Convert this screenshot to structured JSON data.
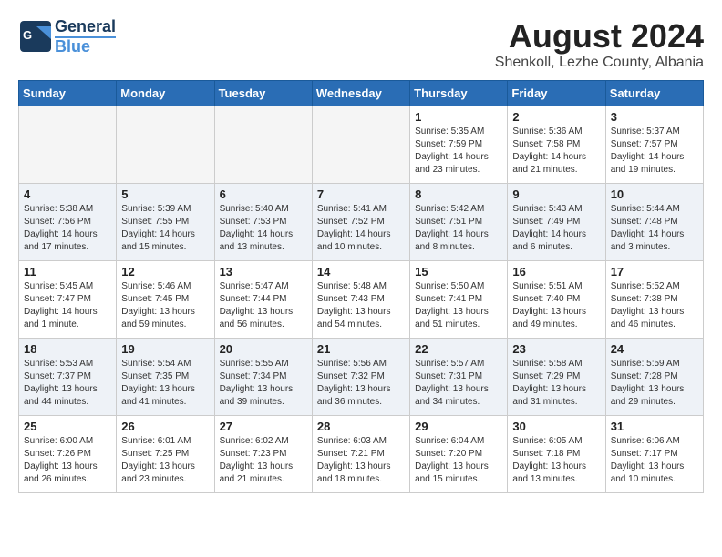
{
  "header": {
    "logo_line1": "General",
    "logo_line2": "Blue",
    "month_year": "August 2024",
    "location": "Shenkoll, Lezhe County, Albania"
  },
  "weekdays": [
    "Sunday",
    "Monday",
    "Tuesday",
    "Wednesday",
    "Thursday",
    "Friday",
    "Saturday"
  ],
  "weeks": [
    [
      {
        "day": "",
        "info": ""
      },
      {
        "day": "",
        "info": ""
      },
      {
        "day": "",
        "info": ""
      },
      {
        "day": "",
        "info": ""
      },
      {
        "day": "1",
        "info": "Sunrise: 5:35 AM\nSunset: 7:59 PM\nDaylight: 14 hours\nand 23 minutes."
      },
      {
        "day": "2",
        "info": "Sunrise: 5:36 AM\nSunset: 7:58 PM\nDaylight: 14 hours\nand 21 minutes."
      },
      {
        "day": "3",
        "info": "Sunrise: 5:37 AM\nSunset: 7:57 PM\nDaylight: 14 hours\nand 19 minutes."
      }
    ],
    [
      {
        "day": "4",
        "info": "Sunrise: 5:38 AM\nSunset: 7:56 PM\nDaylight: 14 hours\nand 17 minutes."
      },
      {
        "day": "5",
        "info": "Sunrise: 5:39 AM\nSunset: 7:55 PM\nDaylight: 14 hours\nand 15 minutes."
      },
      {
        "day": "6",
        "info": "Sunrise: 5:40 AM\nSunset: 7:53 PM\nDaylight: 14 hours\nand 13 minutes."
      },
      {
        "day": "7",
        "info": "Sunrise: 5:41 AM\nSunset: 7:52 PM\nDaylight: 14 hours\nand 10 minutes."
      },
      {
        "day": "8",
        "info": "Sunrise: 5:42 AM\nSunset: 7:51 PM\nDaylight: 14 hours\nand 8 minutes."
      },
      {
        "day": "9",
        "info": "Sunrise: 5:43 AM\nSunset: 7:49 PM\nDaylight: 14 hours\nand 6 minutes."
      },
      {
        "day": "10",
        "info": "Sunrise: 5:44 AM\nSunset: 7:48 PM\nDaylight: 14 hours\nand 3 minutes."
      }
    ],
    [
      {
        "day": "11",
        "info": "Sunrise: 5:45 AM\nSunset: 7:47 PM\nDaylight: 14 hours\nand 1 minute."
      },
      {
        "day": "12",
        "info": "Sunrise: 5:46 AM\nSunset: 7:45 PM\nDaylight: 13 hours\nand 59 minutes."
      },
      {
        "day": "13",
        "info": "Sunrise: 5:47 AM\nSunset: 7:44 PM\nDaylight: 13 hours\nand 56 minutes."
      },
      {
        "day": "14",
        "info": "Sunrise: 5:48 AM\nSunset: 7:43 PM\nDaylight: 13 hours\nand 54 minutes."
      },
      {
        "day": "15",
        "info": "Sunrise: 5:50 AM\nSunset: 7:41 PM\nDaylight: 13 hours\nand 51 minutes."
      },
      {
        "day": "16",
        "info": "Sunrise: 5:51 AM\nSunset: 7:40 PM\nDaylight: 13 hours\nand 49 minutes."
      },
      {
        "day": "17",
        "info": "Sunrise: 5:52 AM\nSunset: 7:38 PM\nDaylight: 13 hours\nand 46 minutes."
      }
    ],
    [
      {
        "day": "18",
        "info": "Sunrise: 5:53 AM\nSunset: 7:37 PM\nDaylight: 13 hours\nand 44 minutes."
      },
      {
        "day": "19",
        "info": "Sunrise: 5:54 AM\nSunset: 7:35 PM\nDaylight: 13 hours\nand 41 minutes."
      },
      {
        "day": "20",
        "info": "Sunrise: 5:55 AM\nSunset: 7:34 PM\nDaylight: 13 hours\nand 39 minutes."
      },
      {
        "day": "21",
        "info": "Sunrise: 5:56 AM\nSunset: 7:32 PM\nDaylight: 13 hours\nand 36 minutes."
      },
      {
        "day": "22",
        "info": "Sunrise: 5:57 AM\nSunset: 7:31 PM\nDaylight: 13 hours\nand 34 minutes."
      },
      {
        "day": "23",
        "info": "Sunrise: 5:58 AM\nSunset: 7:29 PM\nDaylight: 13 hours\nand 31 minutes."
      },
      {
        "day": "24",
        "info": "Sunrise: 5:59 AM\nSunset: 7:28 PM\nDaylight: 13 hours\nand 29 minutes."
      }
    ],
    [
      {
        "day": "25",
        "info": "Sunrise: 6:00 AM\nSunset: 7:26 PM\nDaylight: 13 hours\nand 26 minutes."
      },
      {
        "day": "26",
        "info": "Sunrise: 6:01 AM\nSunset: 7:25 PM\nDaylight: 13 hours\nand 23 minutes."
      },
      {
        "day": "27",
        "info": "Sunrise: 6:02 AM\nSunset: 7:23 PM\nDaylight: 13 hours\nand 21 minutes."
      },
      {
        "day": "28",
        "info": "Sunrise: 6:03 AM\nSunset: 7:21 PM\nDaylight: 13 hours\nand 18 minutes."
      },
      {
        "day": "29",
        "info": "Sunrise: 6:04 AM\nSunset: 7:20 PM\nDaylight: 13 hours\nand 15 minutes."
      },
      {
        "day": "30",
        "info": "Sunrise: 6:05 AM\nSunset: 7:18 PM\nDaylight: 13 hours\nand 13 minutes."
      },
      {
        "day": "31",
        "info": "Sunrise: 6:06 AM\nSunset: 7:17 PM\nDaylight: 13 hours\nand 10 minutes."
      }
    ]
  ]
}
